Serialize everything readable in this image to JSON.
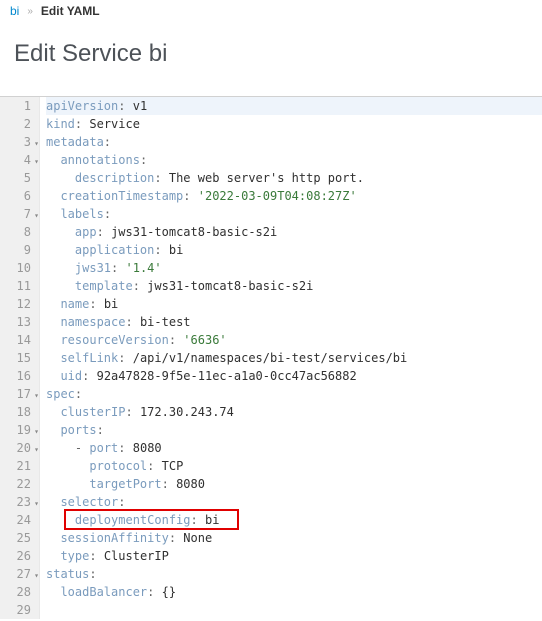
{
  "breadcrumb": {
    "root": "bi",
    "current": "Edit YAML"
  },
  "title": "Edit Service bi",
  "yaml": {
    "apiVersion": "v1",
    "kind": "Service",
    "metadata_annotations_description": "The web server's http port.",
    "metadata_creationTimestamp": "'2022-03-09T04:08:27Z'",
    "metadata_labels_app": "jws31-tomcat8-basic-s2i",
    "metadata_labels_application": "bi",
    "metadata_labels_jws31": "'1.4'",
    "metadata_labels_template": "jws31-tomcat8-basic-s2i",
    "metadata_name": "bi",
    "metadata_namespace": "bi-test",
    "metadata_resourceVersion": "'6636'",
    "metadata_selfLink": "/api/v1/namespaces/bi-test/services/bi",
    "metadata_uid": "92a47828-9f5e-11ec-a1a0-0cc47ac56882",
    "spec_clusterIP": "172.30.243.74",
    "spec_ports_port": "8080",
    "spec_ports_protocol": "TCP",
    "spec_ports_targetPort": "8080",
    "spec_selector_deploymentConfig": "bi",
    "spec_sessionAffinity": "None",
    "spec_type": "ClusterIP",
    "status_loadBalancer": "{}"
  },
  "keys": {
    "apiVersion": "apiVersion",
    "kind": "kind",
    "metadata": "metadata",
    "annotations": "annotations",
    "description": "description",
    "creationTimestamp": "creationTimestamp",
    "labels": "labels",
    "app": "app",
    "application": "application",
    "jws31": "jws31",
    "template": "template",
    "name": "name",
    "namespace": "namespace",
    "resourceVersion": "resourceVersion",
    "selfLink": "selfLink",
    "uid": "uid",
    "spec": "spec",
    "clusterIP": "clusterIP",
    "ports": "ports",
    "port": "port",
    "protocol": "protocol",
    "targetPort": "targetPort",
    "selector": "selector",
    "deploymentConfig": "deploymentConfig",
    "sessionAffinity": "sessionAffinity",
    "type": "type",
    "status": "status",
    "loadBalancer": "loadBalancer"
  },
  "lineNumbers": {
    "l1": "1",
    "l2": "2",
    "l3": "3",
    "l4": "4",
    "l5": "5",
    "l6": "6",
    "l7": "7",
    "l8": "8",
    "l9": "9",
    "l10": "10",
    "l11": "11",
    "l12": "12",
    "l13": "13",
    "l14": "14",
    "l15": "15",
    "l16": "16",
    "l17": "17",
    "l18": "18",
    "l19": "19",
    "l20": "20",
    "l21": "21",
    "l22": "22",
    "l23": "23",
    "l24": "24",
    "l25": "25",
    "l26": "26",
    "l27": "27",
    "l28": "28",
    "l29": "29"
  }
}
